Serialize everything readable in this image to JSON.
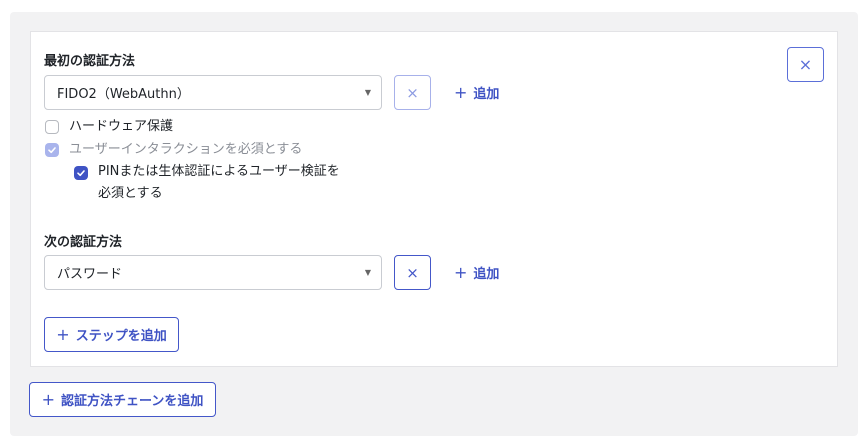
{
  "first_method": {
    "label": "最初の認証方法",
    "select_value": "FIDO2（WebAuthn）",
    "remove_icon": "close-icon",
    "add_label": "追加",
    "options": {
      "hardware": {
        "label": "ハードウェア保護",
        "checked": false
      },
      "user_interaction": {
        "label": "ユーザーインタラクションを必須とする",
        "checked": true,
        "disabled": true
      },
      "pin_or_biometric": {
        "line1": "PINまたは生体認証によるユーザー検証を",
        "line2": "必須とする",
        "checked": true
      }
    }
  },
  "next_method": {
    "label": "次の認証方法",
    "select_value": "パスワード",
    "remove_icon": "close-icon",
    "add_label": "追加"
  },
  "add_step_label": "ステップを追加",
  "add_chain_label": "認証方法チェーンを追加",
  "symbols": {
    "plus": "+",
    "close": "×",
    "caret": "▼"
  },
  "colors": {
    "accent": "#3f53c4",
    "border": "#c9ccd2",
    "panel": "#f2f2f3"
  }
}
